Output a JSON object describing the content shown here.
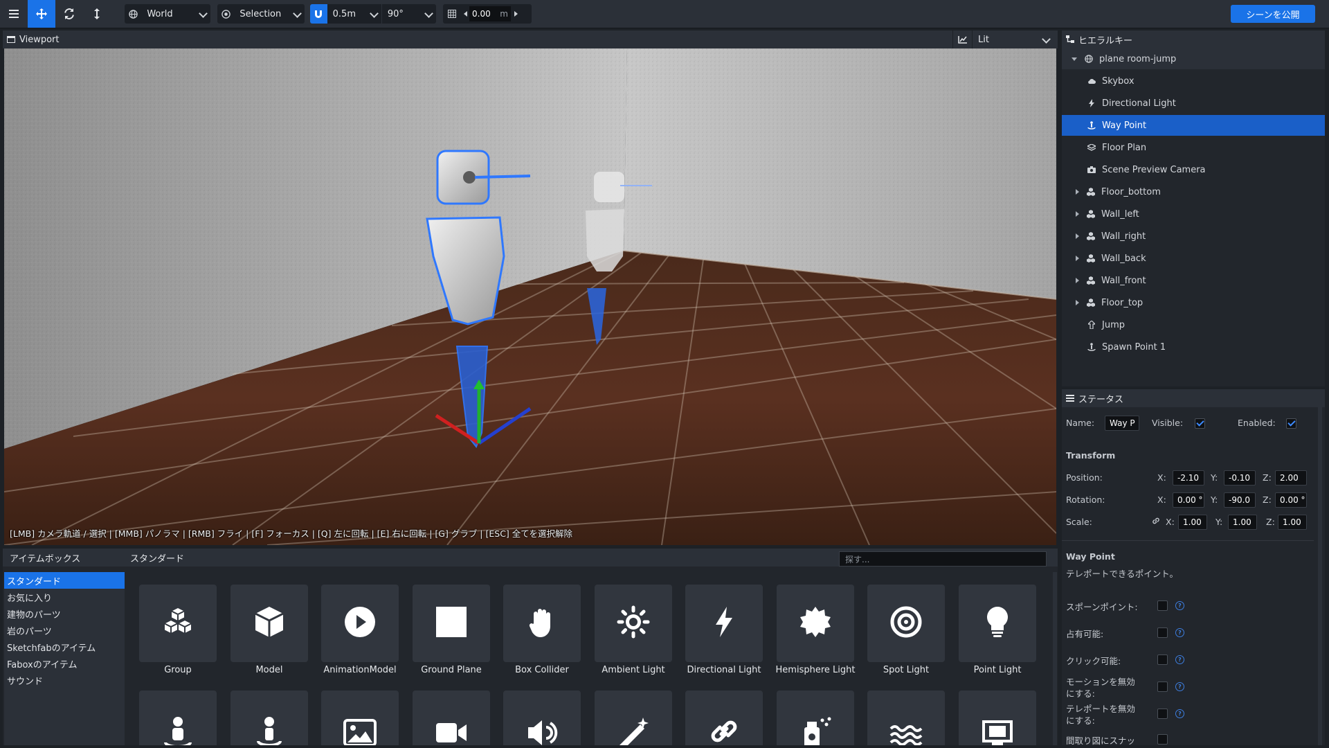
{
  "toolbar": {
    "space": "World",
    "mode": "Selection",
    "snap": "0.5m",
    "angle": "90°",
    "grid_value": "0.00",
    "grid_unit": "m",
    "publish": "シーンを公開"
  },
  "viewport": {
    "title": "Viewport",
    "shading": "Lit",
    "hint": "[LMB] カメラ軌道 / 選択 | [MMB] パノラマ | [RMB] フライ | [F] フォーカス | [Q] 左に回転 | [E] 右に回転 | [G] グラブ | [ESC] 全てを選択解除"
  },
  "hierarchy": {
    "title": "ヒエラルキー",
    "root": "plane room-jump",
    "items": [
      {
        "label": "Skybox",
        "icon": "cloud-icon",
        "expandable": false
      },
      {
        "label": "Directional Light",
        "icon": "bolt-icon",
        "expandable": false
      },
      {
        "label": "Way Point",
        "icon": "waypoint-icon",
        "expandable": false,
        "selected": true
      },
      {
        "label": "Floor Plan",
        "icon": "floorplan-icon",
        "expandable": false
      },
      {
        "label": "Scene Preview Camera",
        "icon": "camera-icon",
        "expandable": false
      },
      {
        "label": "Floor_bottom",
        "icon": "model-icon",
        "expandable": true
      },
      {
        "label": "Wall_left",
        "icon": "model-icon",
        "expandable": true
      },
      {
        "label": "Wall_right",
        "icon": "model-icon",
        "expandable": true
      },
      {
        "label": "Wall_back",
        "icon": "model-icon",
        "expandable": true
      },
      {
        "label": "Wall_front",
        "icon": "model-icon",
        "expandable": true
      },
      {
        "label": "Floor_top",
        "icon": "model-icon",
        "expandable": true
      },
      {
        "label": "Jump",
        "icon": "jump-icon",
        "expandable": false
      },
      {
        "label": "Spawn Point 1",
        "icon": "spawn-icon",
        "expandable": false
      }
    ]
  },
  "status": {
    "title": "ステータス",
    "name_label": "Name:",
    "name_value": "Way P",
    "visible_label": "Visible:",
    "enabled_label": "Enabled:",
    "transform_title": "Transform",
    "position_label": "Position:",
    "rotation_label": "Rotation:",
    "scale_label": "Scale:",
    "x": "X:",
    "y": "Y:",
    "z": "Z:",
    "position": [
      "-2.10",
      "-0.10",
      "2.00"
    ],
    "rotation": [
      "0.00 °",
      "-90.0",
      "0.00 °"
    ],
    "scale": [
      "1.00",
      "1.00",
      "1.00"
    ],
    "component_title": "Way Point",
    "component_desc": "テレポートできるポイント。",
    "options": [
      {
        "label": "スポーンポイント:"
      },
      {
        "label": "占有可能:"
      },
      {
        "label": "クリック可能:"
      },
      {
        "label": "モーションを無効にする:",
        "l1": "モーションを無効",
        "l2": "にする:"
      },
      {
        "label": "テレポートを無効にする:",
        "l1": "テレポートを無効",
        "l2": "にする:"
      },
      {
        "label": "間取り図にスナッ"
      }
    ]
  },
  "itembox": {
    "title": "アイテムボックス",
    "section": "スタンダード",
    "search_placeholder": "探す...",
    "categories": [
      "スタンダード",
      "お気に入り",
      "建物のパーツ",
      "岩のパーツ",
      "Sketchfabのアイテム",
      "Faboxのアイテム",
      "サウンド"
    ],
    "items": [
      "Group",
      "Model",
      "AnimationModel",
      "Ground Plane",
      "Box Collider",
      "Ambient Light",
      "Directional Light",
      "Hemisphere Light",
      "Spot Light",
      "Point Light"
    ],
    "row2_icons": [
      "spawn-point-icon",
      "waypoint-icon",
      "image-icon",
      "video-icon",
      "audio-icon",
      "particle-icon",
      "link-icon",
      "spray-icon",
      "water-icon",
      "screen-icon"
    ]
  }
}
